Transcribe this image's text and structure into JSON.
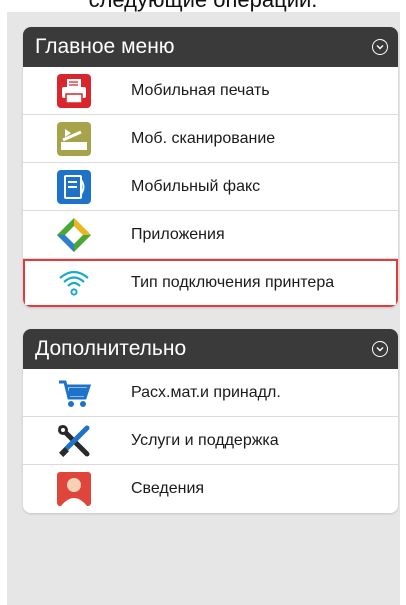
{
  "top": {
    "caption": "следующие операции."
  },
  "main_menu": {
    "title": "Главное меню",
    "items": [
      {
        "label": "Мобильная печать",
        "icon": "printer-icon"
      },
      {
        "label": "Моб. сканирование",
        "icon": "scanner-icon"
      },
      {
        "label": "Мобильный факс",
        "icon": "fax-icon"
      },
      {
        "label": "Приложения",
        "icon": "apps-icon"
      },
      {
        "label": "Тип подключения принтера",
        "icon": "wifi-icon"
      }
    ]
  },
  "additional": {
    "title": "Дополнительно",
    "items": [
      {
        "label": "Расх.мат.и принадл.",
        "icon": "cart-icon"
      },
      {
        "label": "Услуги и поддержка",
        "icon": "tools-icon"
      },
      {
        "label": "Сведения",
        "icon": "person-icon"
      }
    ]
  },
  "colors": {
    "header": "#3a3a3a",
    "highlight": "#e03c3c",
    "background": "#e6e6e6"
  }
}
